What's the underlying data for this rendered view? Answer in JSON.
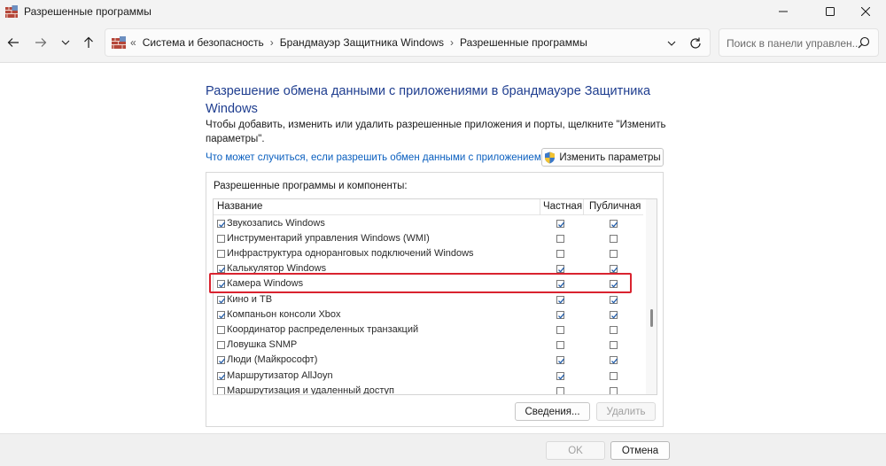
{
  "window": {
    "title": "Разрешенные программы",
    "app_icon": "firewall-icon",
    "controls": [
      "minimize-icon",
      "maximize-icon",
      "close-icon"
    ]
  },
  "nav": {
    "buttons": [
      "back-arrow-icon",
      "forward-arrow-icon",
      "history-dropdown-icon",
      "up-arrow-icon"
    ],
    "address": {
      "overflow_glyph": "«",
      "crumbs": [
        "Система и безопасность",
        "Брандмауэр Защитника Windows",
        "Разрешенные программы"
      ],
      "separator": "›"
    },
    "search_placeholder": "Поиск в панели управлен..."
  },
  "content": {
    "heading": "Разрешение обмена данными с приложениями в брандмауэре Защитника Windows",
    "description": "Чтобы добавить, изменить или удалить разрешенные приложения и порты, щелкните \"Изменить параметры\".",
    "risk_link": "Что может случиться, если разрешить обмен данными с приложением?",
    "change_settings_button": "Изменить параметры",
    "group_label": "Разрешенные программы и компоненты:",
    "columns": {
      "name": "Название",
      "private": "Частная",
      "public": "Публичная"
    },
    "rows": [
      {
        "name": "Звукозапись Windows",
        "enabled": true,
        "private": true,
        "public": true
      },
      {
        "name": "Инструментарий управления Windows (WMI)",
        "enabled": false,
        "private": false,
        "public": false
      },
      {
        "name": "Инфраструктура одноранговых подключений Windows",
        "enabled": false,
        "private": false,
        "public": false
      },
      {
        "name": "Калькулятор Windows",
        "enabled": true,
        "private": true,
        "public": true
      },
      {
        "name": "Камера Windows",
        "enabled": true,
        "private": true,
        "public": true,
        "highlighted": true
      },
      {
        "name": "Кино и ТВ",
        "enabled": true,
        "private": true,
        "public": true
      },
      {
        "name": "Компаньон консоли Xbox",
        "enabled": true,
        "private": true,
        "public": true
      },
      {
        "name": "Координатор распределенных транзакций",
        "enabled": false,
        "private": false,
        "public": false
      },
      {
        "name": "Ловушка SNMP",
        "enabled": false,
        "private": false,
        "public": false
      },
      {
        "name": "Люди (Майкрософт)",
        "enabled": true,
        "private": true,
        "public": true
      },
      {
        "name": "Маршрутизатор AllJoyn",
        "enabled": true,
        "private": true,
        "public": false
      },
      {
        "name": "Маршрутизация и удаленный доступ",
        "enabled": false,
        "private": false,
        "public": false
      }
    ],
    "details_button": "Сведения...",
    "remove_button": "Удалить"
  },
  "footer": {
    "ok": "OK",
    "cancel": "Отмена"
  },
  "colors": {
    "heading": "#1e3d8f",
    "link": "#0a5fbf",
    "highlight": "#d9232f",
    "check": "#1e5aa8"
  }
}
